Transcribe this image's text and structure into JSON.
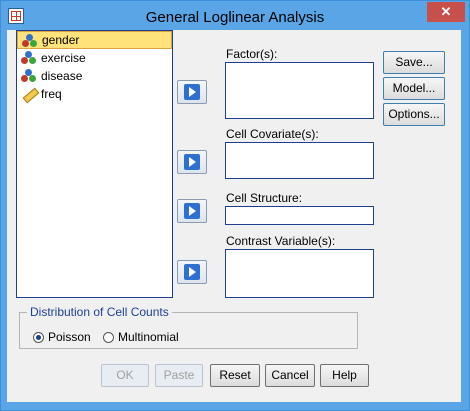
{
  "window": {
    "title": "General Loglinear Analysis",
    "close_label": "✕"
  },
  "variables": [
    {
      "name": "gender",
      "icon": "nominal-variable-icon",
      "selected": true
    },
    {
      "name": "exercise",
      "icon": "nominal-variable-icon",
      "selected": false
    },
    {
      "name": "disease",
      "icon": "nominal-variable-icon",
      "selected": false
    },
    {
      "name": "freq",
      "icon": "scale-variable-icon",
      "selected": false
    }
  ],
  "targets": {
    "factors_label": "Factor(s):",
    "cell_covariates_label": "Cell Covariate(s):",
    "cell_structure_label": "Cell Structure:",
    "contrast_variables_label": "Contrast Variable(s):"
  },
  "side_buttons": {
    "save": "Save...",
    "model": "Model...",
    "options": "Options..."
  },
  "distribution": {
    "title": "Distribution of Cell Counts",
    "poisson": "Poisson",
    "multinomial": "Multinomial",
    "selected": "Poisson"
  },
  "bottom_buttons": {
    "ok": "OK",
    "paste": "Paste",
    "reset": "Reset",
    "cancel": "Cancel",
    "help": "Help"
  },
  "colors": {
    "title_bar": "#5aa5e6",
    "close_button": "#c7504a",
    "selection": "#ffe37a",
    "group_title": "#1c3f94"
  }
}
